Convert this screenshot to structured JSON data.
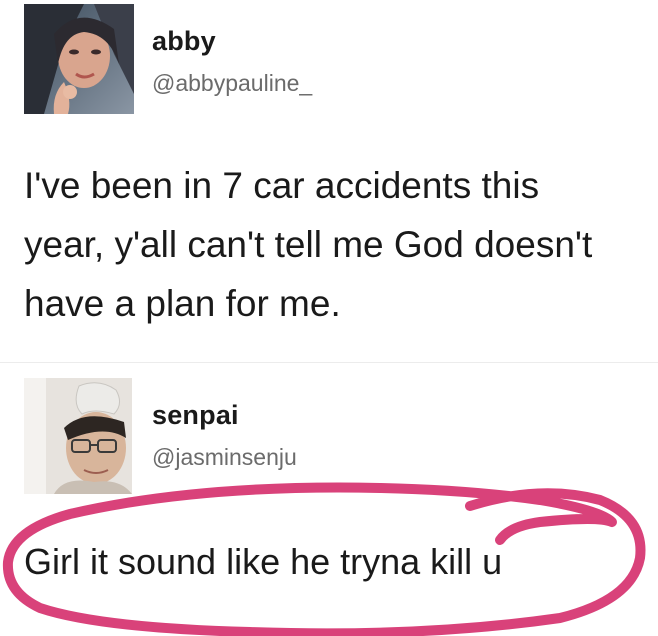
{
  "tweets": [
    {
      "display_name": "abby",
      "handle": "@abbypauline_",
      "text_lines": [
        "I've been in 7 car accidents this",
        "year, y'all can't tell me God doesn't",
        "have a plan for me."
      ]
    },
    {
      "display_name": "senpai",
      "handle": "@jasminsenju",
      "text_lines": [
        "Girl it sound like he tryna kill u"
      ]
    }
  ],
  "colors": {
    "annotation_circle": "#d9427a",
    "handle_gray": "#6b6b6b",
    "text_dark": "#1a1a1a"
  }
}
